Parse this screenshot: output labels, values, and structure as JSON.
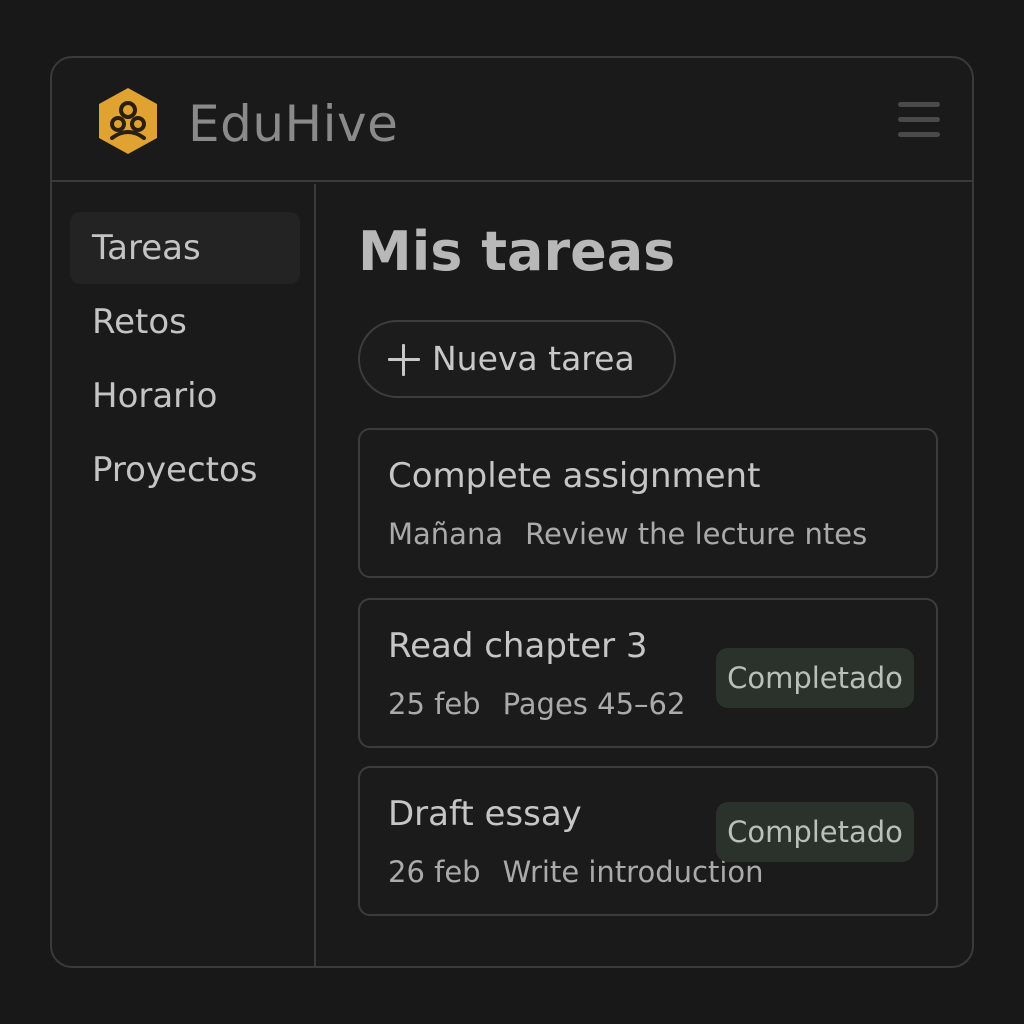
{
  "header": {
    "app_title": "EduHive",
    "logo_icon": "hexagon-people-icon",
    "menu_icon": "hamburger-menu-icon"
  },
  "sidebar": {
    "items": [
      {
        "label": "Tareas",
        "active": true
      },
      {
        "label": "Retos",
        "active": false
      },
      {
        "label": "Horario",
        "active": false
      },
      {
        "label": "Proyectos",
        "active": false
      }
    ]
  },
  "main": {
    "title": "Mis tareas",
    "new_task_label": "Nueva tarea",
    "tasks": [
      {
        "title": "Complete assignment",
        "date": "Mañana",
        "note": "Review the lecture ntes",
        "status": ""
      },
      {
        "title": "Read chapter 3",
        "date": "25 feb",
        "note": "Pages 45–62",
        "status": "Completado"
      },
      {
        "title": "Draft essay",
        "date": "26 feb",
        "note": "Write introduction",
        "status": "Completado"
      }
    ]
  },
  "colors": {
    "background": "#181818",
    "accent": "#e0a332",
    "badge_bg": "#2a322b",
    "border": "#3a3a3a"
  }
}
